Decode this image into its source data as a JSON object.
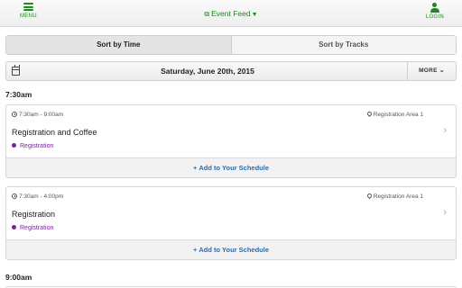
{
  "topbar": {
    "menu_label": "MENU",
    "login_label": "LOGIN",
    "feed_label": "Event Feed"
  },
  "colors": {
    "accent": "#1a8a1a",
    "link": "#2b6cb0",
    "track": "#7b1fa2"
  },
  "sort": {
    "by_time": "Sort by Time",
    "by_tracks": "Sort by Tracks",
    "active": "by_time"
  },
  "datebar": {
    "date": "Saturday, June 20th, 2015",
    "more_label": "MORE"
  },
  "sections": [
    {
      "time": "7:30am",
      "sessions": [
        {
          "time_range": "7:30am - 9:00am",
          "location": "Registration Area 1",
          "title": "Registration and Coffee",
          "track": "Registration",
          "action": "Add to Your Schedule"
        },
        {
          "time_range": "7:30am - 4:00pm",
          "location": "Registration Area 1",
          "title": "Registration",
          "track": "Registration",
          "action": "Add to Your Schedule"
        }
      ]
    },
    {
      "time": "9:00am",
      "sessions": []
    }
  ]
}
